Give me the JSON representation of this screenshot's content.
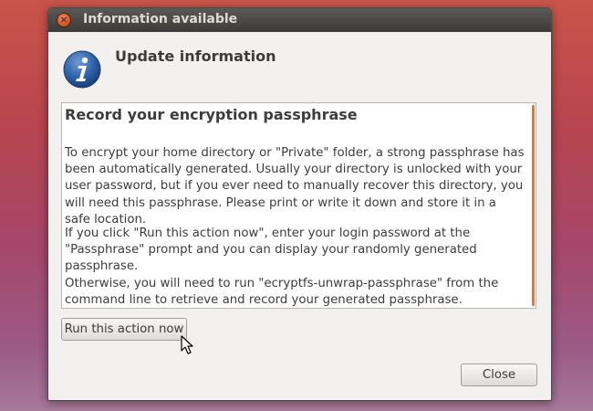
{
  "window": {
    "title": "Information available"
  },
  "header": {
    "title": "Update information",
    "icon": "info-icon"
  },
  "panel": {
    "heading": "Record your encryption passphrase",
    "paragraphs": [
      "To encrypt your home directory or \"Private\" folder, a strong passphrase has been automatically generated. Usually your directory is unlocked with your user password, but if you ever need to manually recover this directory, you will need this passphrase. Please print or write it down and store it in a safe location.",
      "If you click \"Run this action now\", enter your login password at the \"Passphrase\" prompt and you can display your randomly generated passphrase.",
      "Otherwise, you will need to run \"ecryptfs-unwrap-passphrase\" from the command line to retrieve and record your generated passphrase."
    ]
  },
  "buttons": {
    "run_action": "Run this action now",
    "close": "Close"
  },
  "colors": {
    "accent": "#e07642",
    "titlebar": "#3c3b37",
    "close_button": "#e2582a",
    "info_icon": "#2f64a8"
  }
}
